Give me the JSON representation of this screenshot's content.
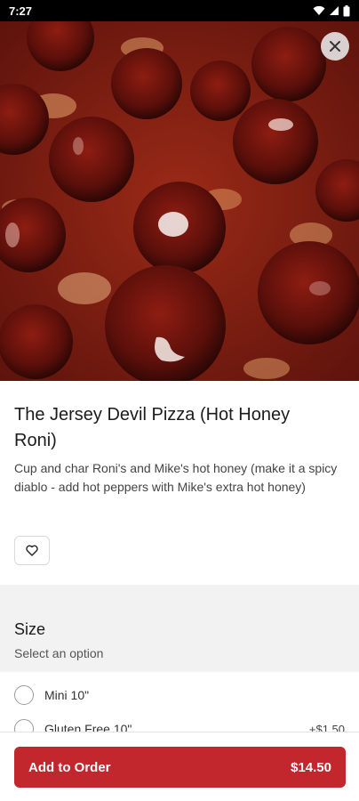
{
  "status_bar": {
    "time": "7:27",
    "icons": [
      "wifi-icon",
      "cell-signal-icon",
      "battery-icon"
    ]
  },
  "hero": {
    "icon": "pepperoni-pizza-photo"
  },
  "close_button": {
    "icon": "close-icon"
  },
  "item": {
    "title": "The Jersey Devil Pizza (Hot Honey Roni)",
    "description": "Cup and char Roni's and Mike's hot honey (make it a spicy diablo - add hot peppers with Mike's extra hot honey)",
    "favorite_icon": "heart-outline-icon"
  },
  "size_section": {
    "title": "Size",
    "subtitle": "Select an option",
    "options": [
      {
        "label": "Mini 10\"",
        "price": ""
      },
      {
        "label": "Gluten Free 10\"",
        "price": "+$1.50"
      }
    ]
  },
  "footer": {
    "add_label": "Add to Order",
    "price": "$14.50"
  },
  "colors": {
    "accent": "#c1272d",
    "status_bar": "#000000",
    "band": "#f2f2f2"
  }
}
